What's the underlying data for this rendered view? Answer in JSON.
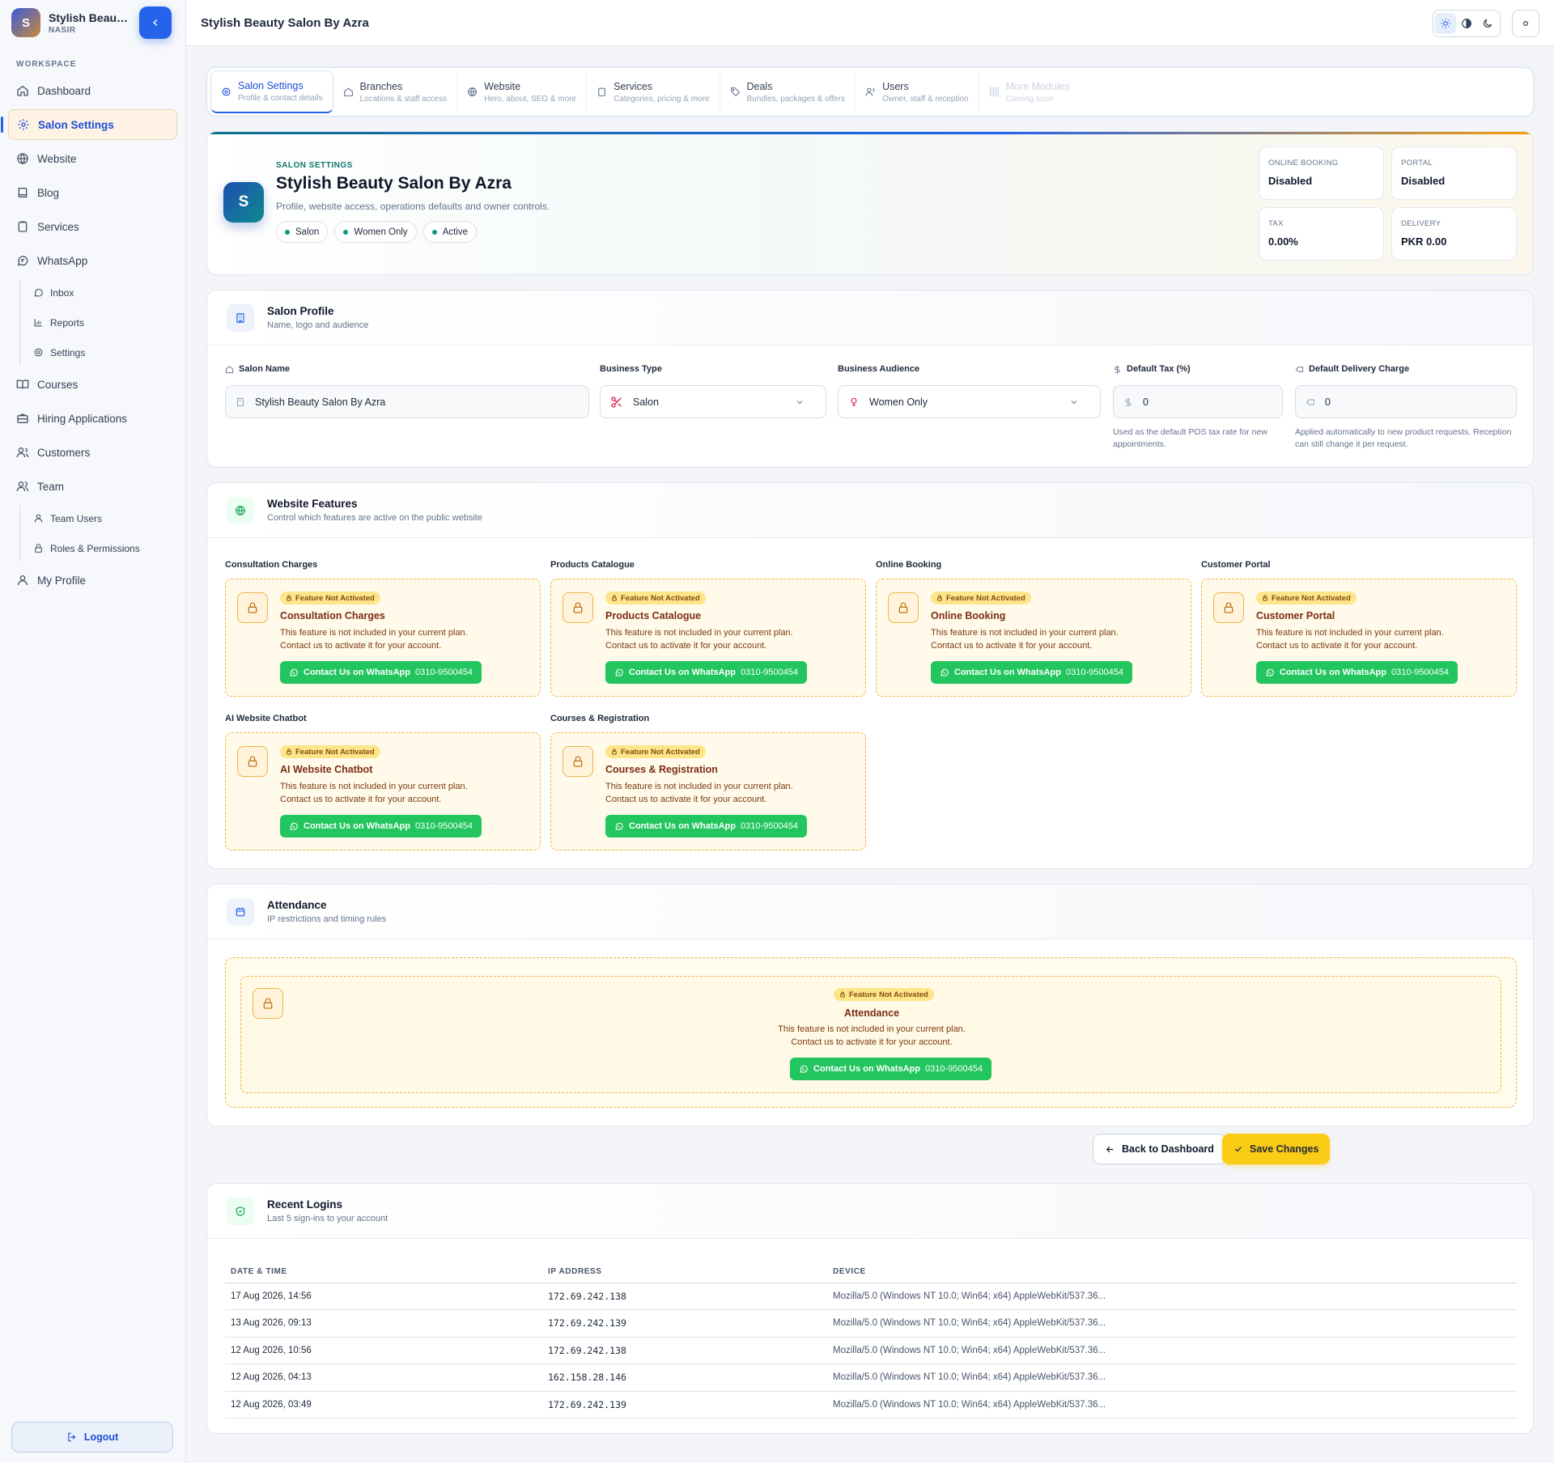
{
  "sidebar": {
    "brand_initial": "S",
    "brand_name": "Stylish Beauty ...",
    "brand_sub": "NASIR",
    "section_label": "WORKSPACE",
    "items": [
      {
        "label": "Dashboard",
        "icon": "home-icon"
      },
      {
        "label": "Salon Settings",
        "icon": "gear-icon",
        "active": true
      },
      {
        "label": "Website",
        "icon": "globe-icon"
      },
      {
        "label": "Blog",
        "icon": "book-icon"
      },
      {
        "label": "Services",
        "icon": "clipboard-icon"
      },
      {
        "label": "WhatsApp",
        "icon": "chat-icon"
      },
      {
        "label": "Courses",
        "icon": "open-book-icon"
      },
      {
        "label": "Hiring Applications",
        "icon": "briefcase-icon"
      },
      {
        "label": "Customers",
        "icon": "users-icon"
      },
      {
        "label": "Team",
        "icon": "team-icon"
      },
      {
        "label": "My Profile",
        "icon": "user-icon"
      }
    ],
    "whatsapp_sub": [
      {
        "label": "Inbox",
        "icon": "chat-bubble-icon"
      },
      {
        "label": "Reports",
        "icon": "bar-chart-icon"
      },
      {
        "label": "Settings",
        "icon": "gear-icon"
      }
    ],
    "team_sub": [
      {
        "label": "Team Users",
        "icon": "user-icon"
      },
      {
        "label": "Roles & Permissions",
        "icon": "lock-icon"
      }
    ],
    "logout_label": "Logout"
  },
  "topbar": {
    "title": "Stylish Beauty Salon By Azra"
  },
  "tabs": [
    {
      "label": "Salon Settings",
      "sub": "Profile & contact details",
      "state": "active"
    },
    {
      "label": "Branches",
      "sub": "Locations & staff access"
    },
    {
      "label": "Website",
      "sub": "Hero, about, SEO & more"
    },
    {
      "label": "Services",
      "sub": "Categories, pricing & more"
    },
    {
      "label": "Deals",
      "sub": "Bundles, packages & offers"
    },
    {
      "label": "Users",
      "sub": "Owner, staff & reception"
    },
    {
      "label": "More Modules",
      "sub": "Coming soon",
      "state": "disabled"
    }
  ],
  "hero": {
    "initial": "S",
    "kicker": "SALON SETTINGS",
    "title": "Stylish Beauty Salon By Azra",
    "description": "Profile, website access, operations defaults and owner controls.",
    "chips": [
      "Salon",
      "Women Only",
      "Active"
    ],
    "stats": [
      {
        "label": "ONLINE BOOKING",
        "value": "Disabled"
      },
      {
        "label": "PORTAL",
        "value": "Disabled"
      },
      {
        "label": "TAX",
        "value": "0.00%"
      },
      {
        "label": "DELIVERY",
        "value": "PKR 0.00"
      }
    ]
  },
  "profile": {
    "title": "Salon Profile",
    "subtitle": "Name, logo and audience",
    "salon_name_label": "Salon Name",
    "salon_name_value": "Stylish Beauty Salon By Azra",
    "business_type_label": "Business Type",
    "business_type_value": "Salon",
    "audience_label": "Business Audience",
    "audience_value": "Women Only",
    "tax_label": "Default Tax (%)",
    "tax_value": "0",
    "tax_hint": "Used as the default POS tax rate for new appointments.",
    "delivery_label": "Default Delivery Charge",
    "delivery_value": "0",
    "delivery_hint": "Applied automatically to new product requests. Reception can still change it per request."
  },
  "features": {
    "title": "Website Features",
    "subtitle": "Control which features are active on the public website",
    "badge": "Feature Not Activated",
    "desc_line1": "This feature is not included in your current plan.",
    "desc_line2": "Contact us to activate it for your account.",
    "button_label": "Contact Us on WhatsApp",
    "phone": "0310-9500454",
    "items": [
      "Consultation Charges",
      "Products Catalogue",
      "Online Booking",
      "Customer Portal",
      "AI Website Chatbot",
      "Courses & Registration"
    ]
  },
  "attendance": {
    "title": "Attendance",
    "subtitle": "IP restrictions and timing rules",
    "feature_title": "Attendance"
  },
  "actions": {
    "back": "Back to Dashboard",
    "save": "Save Changes"
  },
  "logins": {
    "title": "Recent Logins",
    "subtitle": "Last 5 sign-ins to your account",
    "columns": [
      "DATE & TIME",
      "IP ADDRESS",
      "DEVICE"
    ],
    "rows": [
      [
        "17 Aug 2026, 14:56",
        "172.69.242.138",
        "Mozilla/5.0 (Windows NT 10.0; Win64; x64) AppleWebKit/537.36..."
      ],
      [
        "13 Aug 2026, 09:13",
        "172.69.242.139",
        "Mozilla/5.0 (Windows NT 10.0; Win64; x64) AppleWebKit/537.36..."
      ],
      [
        "12 Aug 2026, 10:56",
        "172.69.242.138",
        "Mozilla/5.0 (Windows NT 10.0; Win64; x64) AppleWebKit/537.36..."
      ],
      [
        "12 Aug 2026, 04:13",
        "162.158.28.146",
        "Mozilla/5.0 (Windows NT 10.0; Win64; x64) AppleWebKit/537.36..."
      ],
      [
        "12 Aug 2026, 03:49",
        "172.69.242.139",
        "Mozilla/5.0 (Windows NT 10.0; Win64; x64) AppleWebKit/537.36..."
      ]
    ]
  },
  "colors": {
    "primary": "#2563eb",
    "accent": "#facc15",
    "whatsapp": "#22c55e",
    "warning": "#f2b441"
  }
}
